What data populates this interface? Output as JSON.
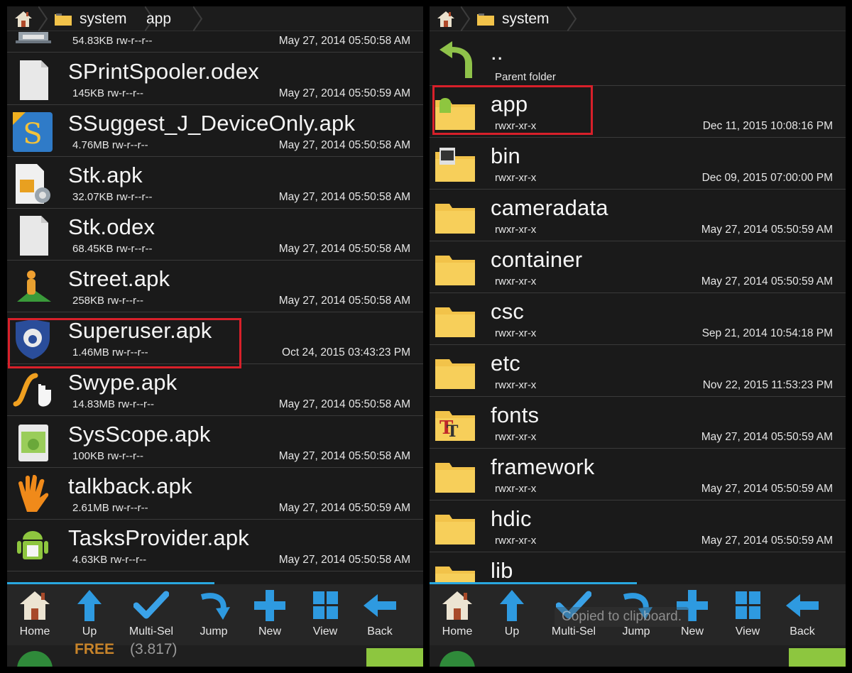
{
  "left": {
    "crumbs": [
      "system",
      "app"
    ],
    "rows": [
      {
        "name": "",
        "meta": "54.83KB rw-r--r--",
        "date": "May 27, 2014 05:50:58 AM",
        "icon": "printer-icon"
      },
      {
        "name": "SPrintSpooler.odex",
        "meta": "145KB rw-r--r--",
        "date": "May 27, 2014 05:50:59 AM",
        "icon": "blank-file-icon"
      },
      {
        "name": "SSuggest_J_DeviceOnly.apk",
        "meta": "4.76MB rw-r--r--",
        "date": "May 27, 2014 05:50:58 AM",
        "icon": "ssuggest-icon"
      },
      {
        "name": "Stk.apk",
        "meta": "32.07KB rw-r--r--",
        "date": "May 27, 2014 05:50:58 AM",
        "icon": "sim-card-icon"
      },
      {
        "name": "Stk.odex",
        "meta": "68.45KB rw-r--r--",
        "date": "May 27, 2014 05:50:58 AM",
        "icon": "blank-file-icon"
      },
      {
        "name": "Street.apk",
        "meta": "258KB rw-r--r--",
        "date": "May 27, 2014 05:50:58 AM",
        "icon": "street-view-icon"
      },
      {
        "name": "Superuser.apk",
        "meta": "1.46MB rw-r--r--",
        "date": "Oct 24, 2015 03:43:23 PM",
        "icon": "superuser-shield-icon"
      },
      {
        "name": "Swype.apk",
        "meta": "14.83MB rw-r--r--",
        "date": "May 27, 2014 05:50:58 AM",
        "icon": "swype-icon"
      },
      {
        "name": "SysScope.apk",
        "meta": "100KB rw-r--r--",
        "date": "May 27, 2014 05:50:58 AM",
        "icon": "android-file-icon"
      },
      {
        "name": "talkback.apk",
        "meta": "2.61MB rw-r--r--",
        "date": "May 27, 2014 05:50:59 AM",
        "icon": "hand-icon"
      },
      {
        "name": "TasksProvider.apk",
        "meta": "4.63KB rw-r--r--",
        "date": "May 27, 2014 05:50:58 AM",
        "icon": "android-robot-icon"
      }
    ],
    "ad": {
      "free": "FREE",
      "rating": "(3.817)"
    }
  },
  "right": {
    "crumbs": [
      "system"
    ],
    "parent": {
      "name": "..",
      "meta": "Parent folder"
    },
    "rows": [
      {
        "name": "app",
        "meta": "rwxr-xr-x",
        "date": "Dec 11, 2015 10:08:16 PM",
        "icon": "android-folder-icon"
      },
      {
        "name": "bin",
        "meta": "rwxr-xr-x",
        "date": "Dec 09, 2015 07:00:00 PM",
        "icon": "terminal-folder-icon"
      },
      {
        "name": "cameradata",
        "meta": "rwxr-xr-x",
        "date": "May 27, 2014 05:50:59 AM",
        "icon": "folder-icon"
      },
      {
        "name": "container",
        "meta": "rwxr-xr-x",
        "date": "May 27, 2014 05:50:59 AM",
        "icon": "folder-icon"
      },
      {
        "name": "csc",
        "meta": "rwxr-xr-x",
        "date": "Sep 21, 2014 10:54:18 PM",
        "icon": "folder-icon"
      },
      {
        "name": "etc",
        "meta": "rwxr-xr-x",
        "date": "Nov 22, 2015 11:53:23 PM",
        "icon": "folder-icon"
      },
      {
        "name": "fonts",
        "meta": "rwxr-xr-x",
        "date": "May 27, 2014 05:50:59 AM",
        "icon": "fonts-folder-icon"
      },
      {
        "name": "framework",
        "meta": "rwxr-xr-x",
        "date": "May 27, 2014 05:50:59 AM",
        "icon": "folder-icon"
      },
      {
        "name": "hdic",
        "meta": "rwxr-xr-x",
        "date": "May 27, 2014 05:50:59 AM",
        "icon": "folder-icon"
      },
      {
        "name": "lib",
        "meta": "",
        "date": "",
        "icon": "folder-icon"
      }
    ],
    "toast": "Copied to clipboard."
  },
  "toolbar": [
    {
      "label": "Home",
      "icon": "home-icon"
    },
    {
      "label": "Up",
      "icon": "up-arrow-icon"
    },
    {
      "label": "Multi-Sel",
      "icon": "checkmark-icon"
    },
    {
      "label": "Jump",
      "icon": "jump-arrow-icon"
    },
    {
      "label": "New",
      "icon": "plus-icon"
    },
    {
      "label": "View",
      "icon": "grid-view-icon"
    },
    {
      "label": "Back",
      "icon": "back-arrow-icon"
    }
  ],
  "colors": {
    "highlight": "#d8202a",
    "accent": "#29a8e0",
    "folder": "#f2c34a"
  }
}
